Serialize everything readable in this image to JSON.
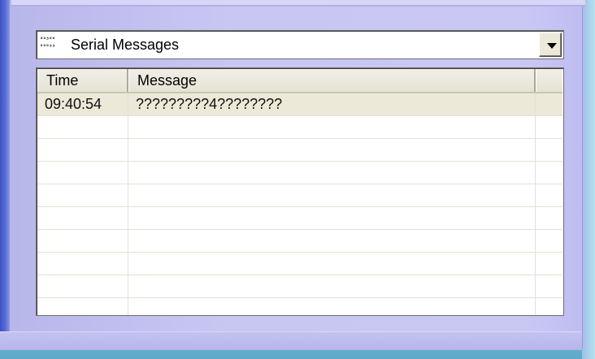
{
  "dropdown": {
    "icon": "serial-port-icon",
    "icon_lines": [
      "°°³°°",
      "°°°³³"
    ],
    "label": "Serial Messages"
  },
  "grid": {
    "columns": [
      "Time",
      "Message",
      ""
    ],
    "rows": [
      {
        "time": "09:40:54",
        "message": "?????????4????????",
        "selected": true
      },
      {
        "time": "",
        "message": "",
        "selected": false
      },
      {
        "time": "",
        "message": "",
        "selected": false
      },
      {
        "time": "",
        "message": "",
        "selected": false
      },
      {
        "time": "",
        "message": "",
        "selected": false
      },
      {
        "time": "",
        "message": "",
        "selected": false
      },
      {
        "time": "",
        "message": "",
        "selected": false
      },
      {
        "time": "",
        "message": "",
        "selected": false
      },
      {
        "time": "",
        "message": "",
        "selected": false
      },
      {
        "time": "",
        "message": "",
        "selected": false
      }
    ]
  },
  "colors": {
    "panel": "#c8c7f3",
    "left_bar": "#3d52c4",
    "selected_row": "#ece9d8"
  }
}
